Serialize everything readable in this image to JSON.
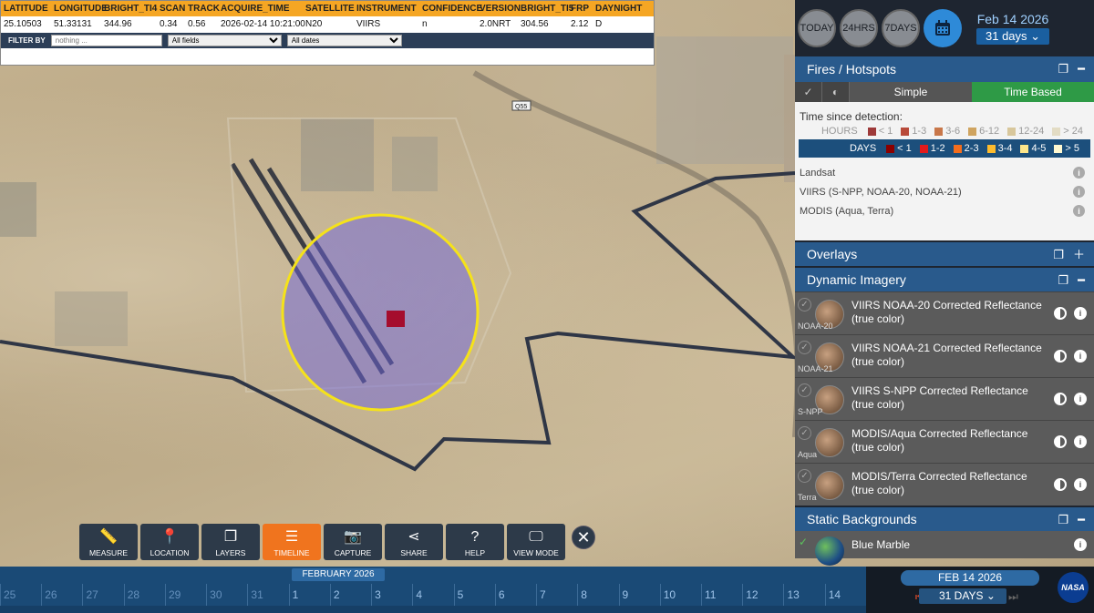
{
  "attribute_table": {
    "headers": [
      "LATITUDE",
      "LONGITUDE",
      "BRIGHT_TI4",
      "SCAN",
      "TRACK",
      "ACQUIRE_TIME",
      "SATELLITE",
      "INSTRUMENT",
      "CONFIDENCE",
      "VERSION",
      "BRIGHT_TI5",
      "FRP",
      "DAYNIGHT"
    ],
    "row": [
      "25.10503",
      "51.33131",
      "344.96",
      "0.34",
      "0.56",
      "2026-02-14 10:21:00",
      "N20",
      "VIIRS",
      "n",
      "2.0NRT",
      "304.56",
      "2.12",
      "D"
    ],
    "filter_label": "FILTER BY",
    "filter_placeholder": "nothing ...",
    "field_select": "All fields",
    "date_select": "All dates"
  },
  "map": {
    "road_label": "Q55"
  },
  "date_selector": {
    "buttons": [
      "TODAY",
      "24HRS",
      "7DAYS"
    ],
    "date": "Feb 14 2026",
    "range": "31 days"
  },
  "fires": {
    "title": "Fires / Hotspots",
    "mode_simple": "Simple",
    "mode_time": "Time Based",
    "time_since": "Time since detection:",
    "hours_label": "HOURS",
    "hours_bins": [
      "< 1",
      "1-3",
      "3-6",
      "6-12",
      "12-24",
      "> 24"
    ],
    "days_label": "DAYS",
    "days_bins": [
      "< 1",
      "1-2",
      "2-3",
      "3-4",
      "4-5",
      "> 5"
    ],
    "sources": [
      "Landsat",
      "VIIRS (S-NPP, NOAA-20, NOAA-21)",
      "MODIS (Aqua, Terra)"
    ],
    "colors": {
      "hours": [
        "#9e3a3a",
        "#b84a3a",
        "#c8774a",
        "#cfa460",
        "#d8c79c",
        "#e3dcc4"
      ],
      "days": [
        "#8b0000",
        "#e31a1c",
        "#f46d1c",
        "#fdbb2d",
        "#fde68a",
        "#fff8d0"
      ]
    }
  },
  "overlays": {
    "title": "Overlays"
  },
  "dynamic": {
    "title": "Dynamic Imagery",
    "layers": [
      {
        "name": "VIIRS NOAA-20 Corrected Reflectance (true color)",
        "tag": "NOAA-20"
      },
      {
        "name": "VIIRS NOAA-21 Corrected Reflectance (true color)",
        "tag": "NOAA-21"
      },
      {
        "name": "VIIRS S-NPP Corrected Reflectance (true color)",
        "tag": "S-NPP"
      },
      {
        "name": "MODIS/Aqua Corrected Reflectance (true color)",
        "tag": "Aqua"
      },
      {
        "name": "MODIS/Terra Corrected Reflectance (true color)",
        "tag": "Terra"
      }
    ]
  },
  "static_bg": {
    "title": "Static Backgrounds",
    "layer": "Blue Marble"
  },
  "toolbar": {
    "items": [
      "MEASURE",
      "LOCATION",
      "LAYERS",
      "TIMELINE",
      "CAPTURE",
      "SHARE",
      "HELP",
      "VIEW MODE"
    ],
    "active": "TIMELINE"
  },
  "timeline": {
    "month": "FEBRUARY 2026",
    "ticks": [
      "25",
      "26",
      "27",
      "28",
      "29",
      "30",
      "31",
      "1",
      "2",
      "3",
      "4",
      "5",
      "6",
      "7",
      "8",
      "9",
      "10",
      "11",
      "12",
      "13",
      "14"
    ],
    "date": "FEB 14 2026",
    "days": "31 DAYS",
    "logo": "NASA"
  }
}
